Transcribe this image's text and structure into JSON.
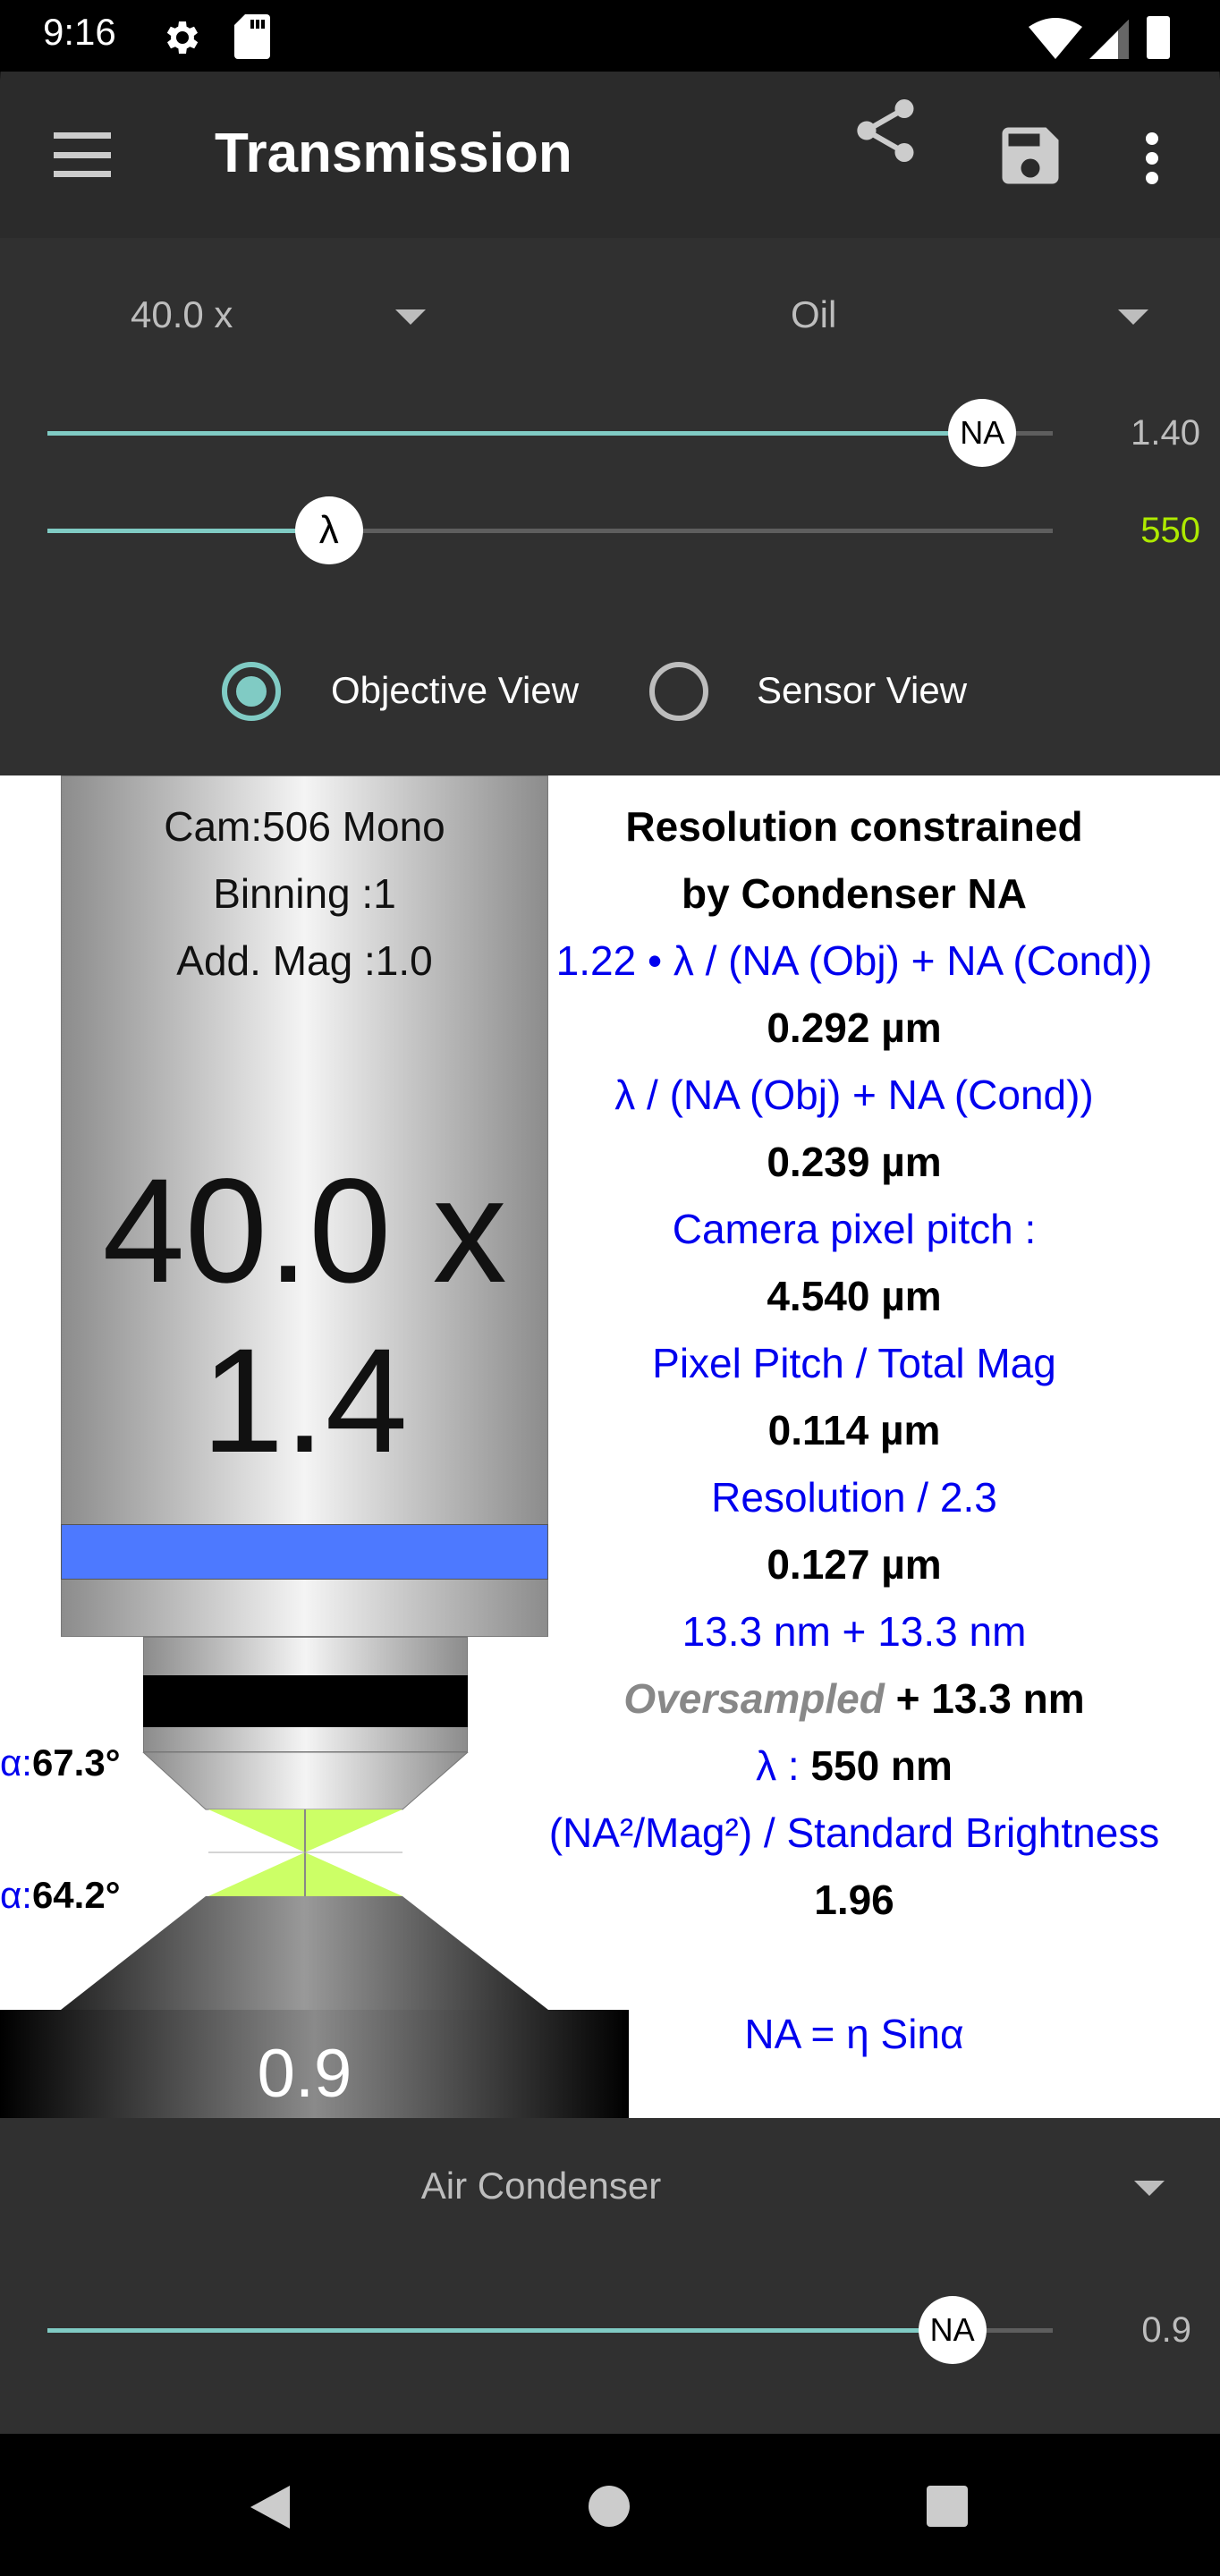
{
  "status_bar": {
    "time": "9:16",
    "icons": [
      "gear-icon",
      "sd-card-icon",
      "wifi-icon",
      "signal-icon",
      "battery-icon"
    ]
  },
  "toolbar": {
    "title": "Transmission",
    "icons": [
      "menu-icon",
      "share-icon",
      "save-icon",
      "more-vert-icon"
    ]
  },
  "controls": {
    "magnification": "40.0 x",
    "immersion": "Oil",
    "na_slider": {
      "thumb_label": "NA",
      "value": "1.40",
      "fraction": 0.93
    },
    "wavelength_slider": {
      "thumb_label": "λ",
      "value": "550",
      "fraction": 0.28,
      "value_color": "#aeea00"
    },
    "view_options": [
      {
        "label": "Objective View",
        "selected": true
      },
      {
        "label": "Sensor View",
        "selected": false
      }
    ]
  },
  "objective": {
    "camera": "Cam:506 Mono",
    "binning": "Binning :1",
    "add_mag": "Add. Mag :1.0",
    "mag": "40.0 x",
    "na": "1.4",
    "band_color": "#4d79ff",
    "alpha_obj_label": "α:",
    "alpha_obj": "67.3°",
    "alpha_cond_label": "α:",
    "alpha_cond": "64.2°",
    "condenser_na": "0.9"
  },
  "results": {
    "heading1": "Resolution constrained",
    "heading2": "by Condenser NA",
    "f1": "1.22 • λ / (NA (Obj) + NA (Cond))",
    "v1": "0.292 µm",
    "f2": "λ / (NA (Obj) + NA (Cond))",
    "v2": "0.239 µm",
    "f3": "Camera pixel pitch :",
    "v3": "4.540 µm",
    "f4": "Pixel Pitch / Total Mag",
    "v4": "0.114 µm",
    "f5": "Resolution / 2.3",
    "v5": "0.127 µm",
    "f6": "13.3 nm + 13.3 nm",
    "oversampled": "Oversampled",
    "ov_value": "+  13.3 nm",
    "lambda_label": "λ :",
    "lambda_value": "550 nm",
    "f7": "(NA²/Mag²) / Standard Brightness",
    "v7": "1.96",
    "na_formula": "NA = η Sinα"
  },
  "condenser": {
    "type": "Air Condenser",
    "slider": {
      "thumb_label": "NA",
      "value": "0.9",
      "fraction": 0.9
    }
  },
  "nav": {
    "icons": [
      "back-icon",
      "home-icon",
      "recents-icon"
    ]
  }
}
